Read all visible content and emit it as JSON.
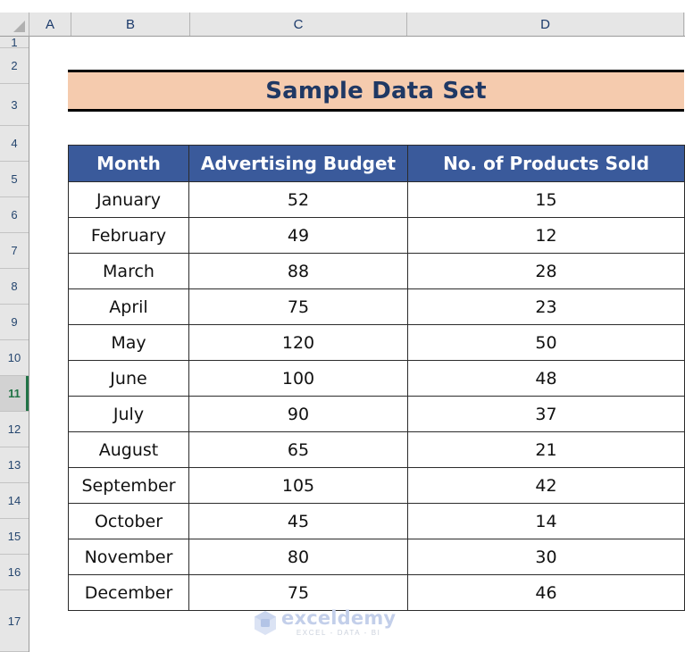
{
  "app": {
    "type": "spreadsheet",
    "select_all_label": "",
    "active_row": "11"
  },
  "grid": {
    "column_headers": [
      "A",
      "B",
      "C",
      "D"
    ],
    "row_headers": [
      "1",
      "2",
      "3",
      "4",
      "5",
      "6",
      "7",
      "8",
      "9",
      "10",
      "11",
      "12",
      "13",
      "14",
      "15",
      "16",
      "17"
    ]
  },
  "title_banner": {
    "text": "Sample Data Set",
    "fill_color": "#F5CBAE",
    "text_color": "#1F3864",
    "border_color": "#000000"
  },
  "table": {
    "header_fill": "#3A5A9B",
    "header_text_color": "#FFFFFF",
    "border_color": "#2B2B2B",
    "columns": [
      "Month",
      "Advertising Budget",
      "No. of Products Sold"
    ],
    "rows": [
      [
        "January",
        "52",
        "15"
      ],
      [
        "February",
        "49",
        "12"
      ],
      [
        "March",
        "88",
        "28"
      ],
      [
        "April",
        "75",
        "23"
      ],
      [
        "May",
        "120",
        "50"
      ],
      [
        "June",
        "100",
        "48"
      ],
      [
        "July",
        "90",
        "37"
      ],
      [
        "August",
        "65",
        "21"
      ],
      [
        "September",
        "105",
        "42"
      ],
      [
        "October",
        "45",
        "14"
      ],
      [
        "November",
        "80",
        "30"
      ],
      [
        "December",
        "75",
        "46"
      ]
    ]
  },
  "watermark": {
    "name": "exceldemy",
    "tagline": "EXCEL - DATA - BI",
    "color": "#C3CFEA"
  },
  "chart_data": {
    "type": "table",
    "title": "Sample Data Set",
    "columns": [
      "Month",
      "Advertising Budget",
      "No. of Products Sold"
    ],
    "categories": [
      "January",
      "February",
      "March",
      "April",
      "May",
      "June",
      "July",
      "August",
      "September",
      "October",
      "November",
      "December"
    ],
    "series": [
      {
        "name": "Advertising Budget",
        "values": [
          52,
          49,
          88,
          75,
          120,
          100,
          90,
          65,
          105,
          45,
          80,
          75
        ]
      },
      {
        "name": "No. of Products Sold",
        "values": [
          15,
          12,
          28,
          23,
          50,
          48,
          37,
          21,
          42,
          14,
          30,
          46
        ]
      }
    ],
    "xlabel": "Month",
    "ylabel": "",
    "grid": true,
    "legend": "none"
  }
}
